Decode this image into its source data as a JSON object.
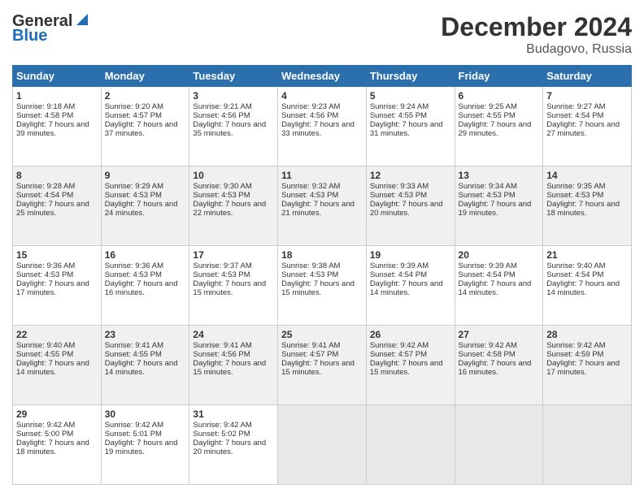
{
  "header": {
    "logo_general": "General",
    "logo_blue": "Blue",
    "title": "December 2024",
    "subtitle": "Budagovo, Russia"
  },
  "calendar": {
    "days_of_week": [
      "Sunday",
      "Monday",
      "Tuesday",
      "Wednesday",
      "Thursday",
      "Friday",
      "Saturday"
    ],
    "weeks": [
      [
        {
          "day": "1",
          "sunrise": "Sunrise: 9:18 AM",
          "sunset": "Sunset: 4:58 PM",
          "daylight": "Daylight: 7 hours and 39 minutes."
        },
        {
          "day": "2",
          "sunrise": "Sunrise: 9:20 AM",
          "sunset": "Sunset: 4:57 PM",
          "daylight": "Daylight: 7 hours and 37 minutes."
        },
        {
          "day": "3",
          "sunrise": "Sunrise: 9:21 AM",
          "sunset": "Sunset: 4:56 PM",
          "daylight": "Daylight: 7 hours and 35 minutes."
        },
        {
          "day": "4",
          "sunrise": "Sunrise: 9:23 AM",
          "sunset": "Sunset: 4:56 PM",
          "daylight": "Daylight: 7 hours and 33 minutes."
        },
        {
          "day": "5",
          "sunrise": "Sunrise: 9:24 AM",
          "sunset": "Sunset: 4:55 PM",
          "daylight": "Daylight: 7 hours and 31 minutes."
        },
        {
          "day": "6",
          "sunrise": "Sunrise: 9:25 AM",
          "sunset": "Sunset: 4:55 PM",
          "daylight": "Daylight: 7 hours and 29 minutes."
        },
        {
          "day": "7",
          "sunrise": "Sunrise: 9:27 AM",
          "sunset": "Sunset: 4:54 PM",
          "daylight": "Daylight: 7 hours and 27 minutes."
        }
      ],
      [
        {
          "day": "8",
          "sunrise": "Sunrise: 9:28 AM",
          "sunset": "Sunset: 4:54 PM",
          "daylight": "Daylight: 7 hours and 25 minutes."
        },
        {
          "day": "9",
          "sunrise": "Sunrise: 9:29 AM",
          "sunset": "Sunset: 4:53 PM",
          "daylight": "Daylight: 7 hours and 24 minutes."
        },
        {
          "day": "10",
          "sunrise": "Sunrise: 9:30 AM",
          "sunset": "Sunset: 4:53 PM",
          "daylight": "Daylight: 7 hours and 22 minutes."
        },
        {
          "day": "11",
          "sunrise": "Sunrise: 9:32 AM",
          "sunset": "Sunset: 4:53 PM",
          "daylight": "Daylight: 7 hours and 21 minutes."
        },
        {
          "day": "12",
          "sunrise": "Sunrise: 9:33 AM",
          "sunset": "Sunset: 4:53 PM",
          "daylight": "Daylight: 7 hours and 20 minutes."
        },
        {
          "day": "13",
          "sunrise": "Sunrise: 9:34 AM",
          "sunset": "Sunset: 4:53 PM",
          "daylight": "Daylight: 7 hours and 19 minutes."
        },
        {
          "day": "14",
          "sunrise": "Sunrise: 9:35 AM",
          "sunset": "Sunset: 4:53 PM",
          "daylight": "Daylight: 7 hours and 18 minutes."
        }
      ],
      [
        {
          "day": "15",
          "sunrise": "Sunrise: 9:36 AM",
          "sunset": "Sunset: 4:53 PM",
          "daylight": "Daylight: 7 hours and 17 minutes."
        },
        {
          "day": "16",
          "sunrise": "Sunrise: 9:36 AM",
          "sunset": "Sunset: 4:53 PM",
          "daylight": "Daylight: 7 hours and 16 minutes."
        },
        {
          "day": "17",
          "sunrise": "Sunrise: 9:37 AM",
          "sunset": "Sunset: 4:53 PM",
          "daylight": "Daylight: 7 hours and 15 minutes."
        },
        {
          "day": "18",
          "sunrise": "Sunrise: 9:38 AM",
          "sunset": "Sunset: 4:53 PM",
          "daylight": "Daylight: 7 hours and 15 minutes."
        },
        {
          "day": "19",
          "sunrise": "Sunrise: 9:39 AM",
          "sunset": "Sunset: 4:54 PM",
          "daylight": "Daylight: 7 hours and 14 minutes."
        },
        {
          "day": "20",
          "sunrise": "Sunrise: 9:39 AM",
          "sunset": "Sunset: 4:54 PM",
          "daylight": "Daylight: 7 hours and 14 minutes."
        },
        {
          "day": "21",
          "sunrise": "Sunrise: 9:40 AM",
          "sunset": "Sunset: 4:54 PM",
          "daylight": "Daylight: 7 hours and 14 minutes."
        }
      ],
      [
        {
          "day": "22",
          "sunrise": "Sunrise: 9:40 AM",
          "sunset": "Sunset: 4:55 PM",
          "daylight": "Daylight: 7 hours and 14 minutes."
        },
        {
          "day": "23",
          "sunrise": "Sunrise: 9:41 AM",
          "sunset": "Sunset: 4:55 PM",
          "daylight": "Daylight: 7 hours and 14 minutes."
        },
        {
          "day": "24",
          "sunrise": "Sunrise: 9:41 AM",
          "sunset": "Sunset: 4:56 PM",
          "daylight": "Daylight: 7 hours and 15 minutes."
        },
        {
          "day": "25",
          "sunrise": "Sunrise: 9:41 AM",
          "sunset": "Sunset: 4:57 PM",
          "daylight": "Daylight: 7 hours and 15 minutes."
        },
        {
          "day": "26",
          "sunrise": "Sunrise: 9:42 AM",
          "sunset": "Sunset: 4:57 PM",
          "daylight": "Daylight: 7 hours and 15 minutes."
        },
        {
          "day": "27",
          "sunrise": "Sunrise: 9:42 AM",
          "sunset": "Sunset: 4:58 PM",
          "daylight": "Daylight: 7 hours and 16 minutes."
        },
        {
          "day": "28",
          "sunrise": "Sunrise: 9:42 AM",
          "sunset": "Sunset: 4:59 PM",
          "daylight": "Daylight: 7 hours and 17 minutes."
        }
      ],
      [
        {
          "day": "29",
          "sunrise": "Sunrise: 9:42 AM",
          "sunset": "Sunset: 5:00 PM",
          "daylight": "Daylight: 7 hours and 18 minutes."
        },
        {
          "day": "30",
          "sunrise": "Sunrise: 9:42 AM",
          "sunset": "Sunset: 5:01 PM",
          "daylight": "Daylight: 7 hours and 19 minutes."
        },
        {
          "day": "31",
          "sunrise": "Sunrise: 9:42 AM",
          "sunset": "Sunset: 5:02 PM",
          "daylight": "Daylight: 7 hours and 20 minutes."
        },
        null,
        null,
        null,
        null
      ]
    ]
  }
}
